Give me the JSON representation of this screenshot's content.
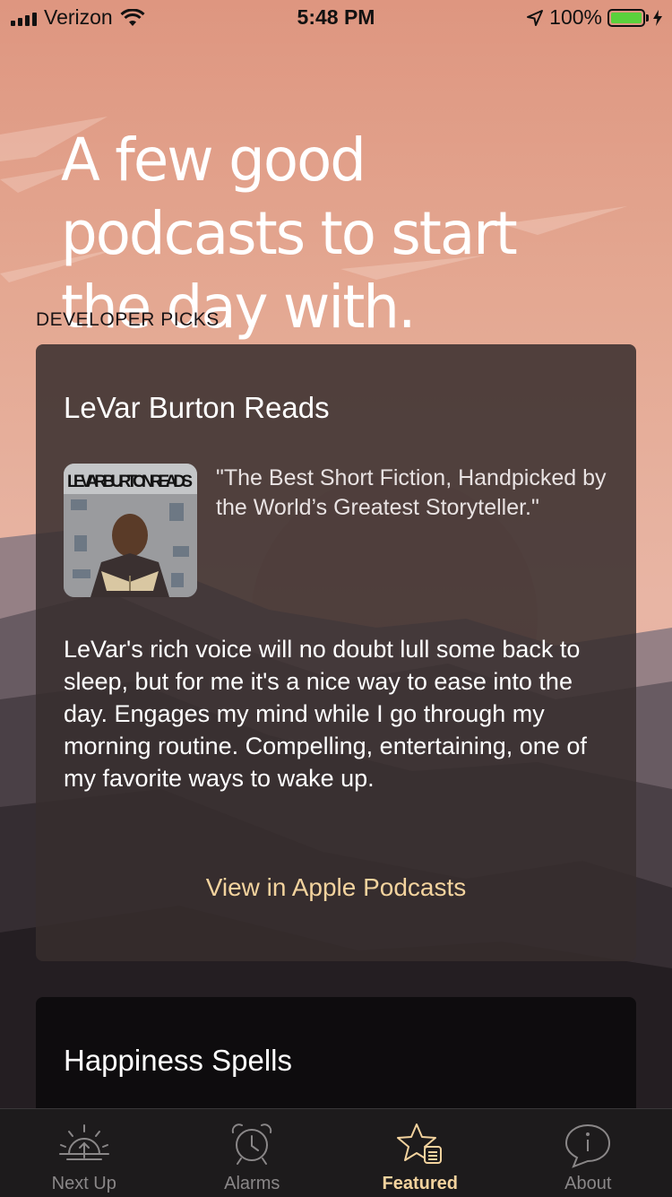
{
  "status_bar": {
    "carrier": "Verizon",
    "time": "5:48 PM",
    "battery": "100%",
    "battery_level": 1.0,
    "icons": [
      "signal-icon",
      "wifi-icon",
      "location-arrow-icon",
      "battery-icon",
      "charging-bolt-icon"
    ]
  },
  "headline": "A few good podcasts to start the day with.",
  "section_label": "DEVELOPER PICKS",
  "cards": [
    {
      "title": "LeVar Burton Reads",
      "artwork_text": "LEVAR BURTON READS",
      "tagline": "\"The Best Short Fiction, Handpicked by the World’s Greatest Storyteller.\"",
      "description": "LeVar's rich voice will no doubt lull some back to sleep, but for me it's a nice way to ease into the day. Engages my mind while I go through my morning routine. Compelling, entertaining, one of my favorite ways to wake up.",
      "link": "View in Apple Podcasts"
    },
    {
      "title": "Happiness Spells"
    }
  ],
  "tabs": [
    {
      "label": "Next Up",
      "icon": "sunrise-icon",
      "active": false
    },
    {
      "label": "Alarms",
      "icon": "alarm-clock-icon",
      "active": false
    },
    {
      "label": "Featured",
      "icon": "star-list-icon",
      "active": true
    },
    {
      "label": "About",
      "icon": "info-icon",
      "active": false
    }
  ],
  "colors": {
    "accent": "#f3d39e",
    "sky_top": "#e0987f",
    "sky_bottom": "#e8b7a6",
    "tab_inactive": "#8a8788"
  }
}
